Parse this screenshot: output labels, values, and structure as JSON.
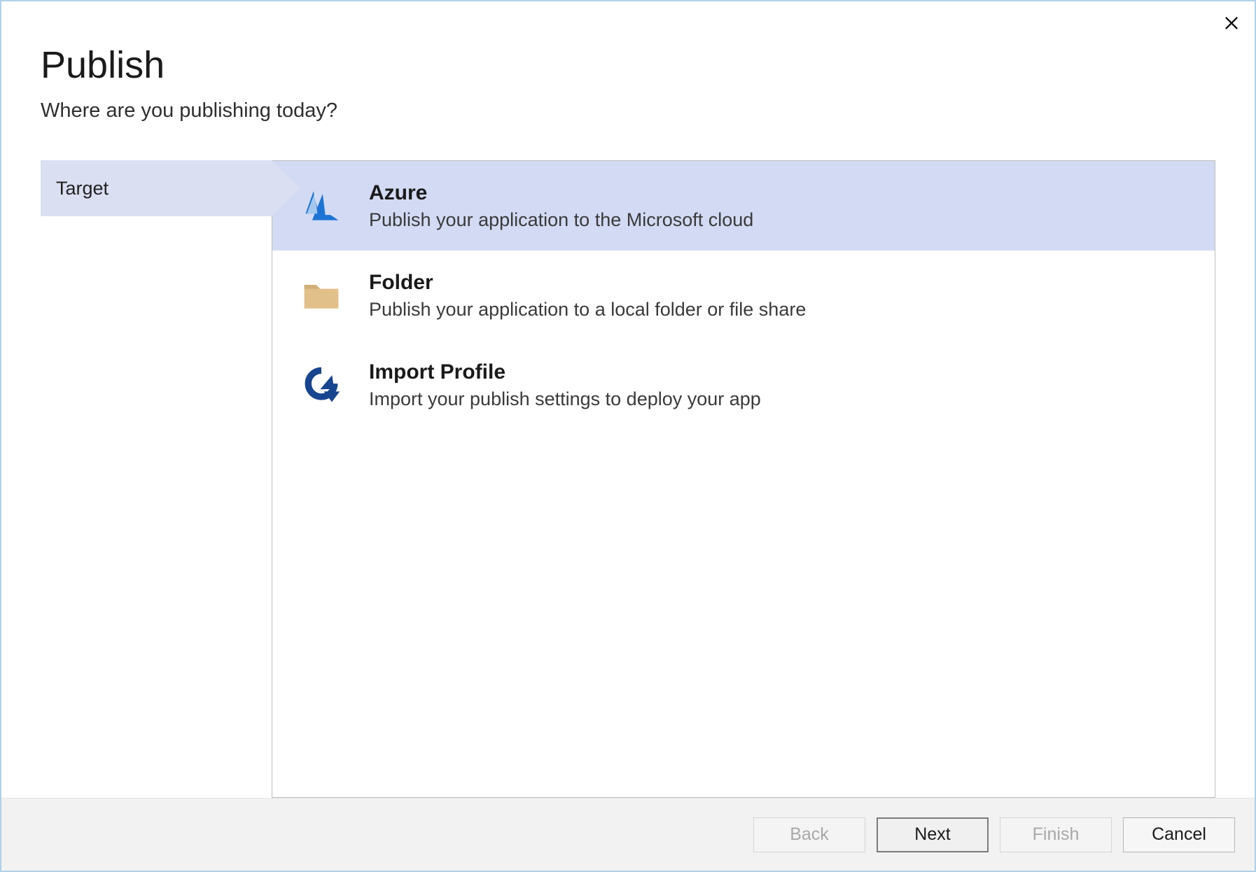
{
  "header": {
    "title": "Publish",
    "subtitle": "Where are you publishing today?"
  },
  "steps": [
    {
      "label": "Target"
    }
  ],
  "options": [
    {
      "icon": "azure",
      "title": "Azure",
      "description": "Publish your application to the Microsoft cloud",
      "selected": true
    },
    {
      "icon": "folder",
      "title": "Folder",
      "description": "Publish your application to a local folder or file share",
      "selected": false
    },
    {
      "icon": "import",
      "title": "Import Profile",
      "description": "Import your publish settings to deploy your app",
      "selected": false
    }
  ],
  "footer": {
    "back": "Back",
    "next": "Next",
    "finish": "Finish",
    "cancel": "Cancel",
    "back_enabled": false,
    "next_enabled": true,
    "finish_enabled": false,
    "cancel_enabled": true
  }
}
